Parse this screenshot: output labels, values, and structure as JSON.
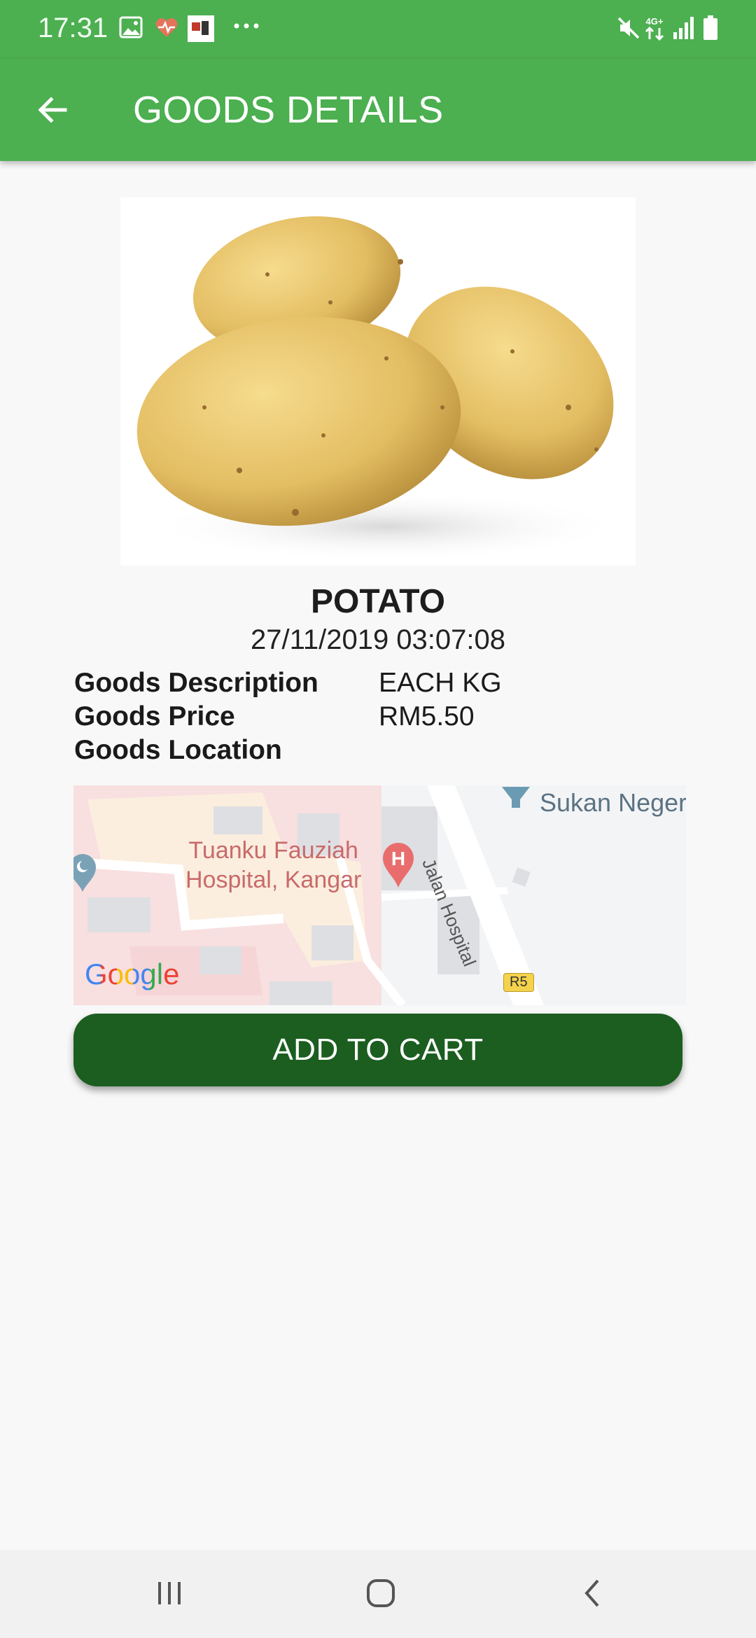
{
  "status_bar": {
    "time": "17:31",
    "icons": [
      "gallery-icon",
      "health-icon",
      "app-notification-icon",
      "more-dots-icon",
      "mute-icon",
      "4g-data-icon",
      "signal-icon",
      "battery-icon"
    ],
    "network": "4G+"
  },
  "app_bar": {
    "title": "GOODS DETAILS",
    "back_icon": "arrow-back-icon",
    "color": "#4caf50"
  },
  "product": {
    "name": "POTATO",
    "date": "27/11/2019 03:07:08",
    "details": [
      {
        "label": "Goods Description",
        "value": "EACH KG"
      },
      {
        "label": "Goods Price",
        "value": "RM5.50"
      },
      {
        "label": "Goods Location",
        "value": ""
      }
    ]
  },
  "map": {
    "place": "Tuanku Fauziah\nHospital, Kangar",
    "place_line1": "Tuanku Fauziah",
    "place_line2": "Hospital, Kangar",
    "road": "Jalan Hospital",
    "poi": "Sukan Neger",
    "route": "R5",
    "provider": "Google",
    "hospital_marker": "H"
  },
  "actions": {
    "add_to_cart": "ADD TO CART",
    "button_color": "#1b5e20"
  },
  "nav_bar": {
    "buttons": [
      "recent-apps-icon",
      "home-icon",
      "back-icon"
    ]
  }
}
